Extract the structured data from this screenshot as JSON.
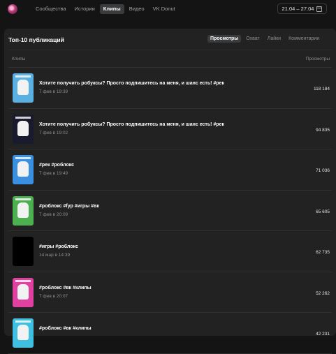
{
  "nav": {
    "tabs": [
      "Сообщества",
      "Истории",
      "Клипы",
      "Видео",
      "VK Donut"
    ],
    "active": "Клипы"
  },
  "date_range": "21.04 – 27.04",
  "panel": {
    "title": "Топ-10 публикаций",
    "metric_tabs": [
      "Просмотры",
      "Охват",
      "Лайки",
      "Комментарии"
    ],
    "active_metric": "Просмотры"
  },
  "table": {
    "col_left": "Клипы",
    "col_right": "Просмотры",
    "rows": [
      {
        "title": "Хотите получить робуксы? Просто подпишитесь на меня, и шанс есть! #рек",
        "date": "7 фев в 19:39",
        "views": "118 184",
        "thumb_bg": "#5ab0e0"
      },
      {
        "title": "Хотите получить робуксы? Просто подпишитесь на меня, и шанс есть! #рек",
        "date": "7 фев в 19:02",
        "views": "94 835",
        "thumb_bg": "#1a1a2e"
      },
      {
        "title": "#рек #роблокс",
        "date": "7 фев в 19:49",
        "views": "71 036",
        "thumb_bg": "#3b8fe0"
      },
      {
        "title": "#роблокс #fyp #игры #вк",
        "date": "7 фев в 20:09",
        "views": "65 605",
        "thumb_bg": "#4caf50"
      },
      {
        "title": "#игры #роблокс",
        "date": "14 мар в 14:39",
        "views": "62 735",
        "thumb_bg": "#000000"
      },
      {
        "title": "#роблокс #вк #клипы",
        "date": "7 фев в 20:07",
        "views": "52 262",
        "thumb_bg": "#e040a0"
      },
      {
        "title": "#роблокс #вк #клипы",
        "date": "",
        "views": "42 231",
        "thumb_bg": "#40c0e0"
      }
    ]
  }
}
